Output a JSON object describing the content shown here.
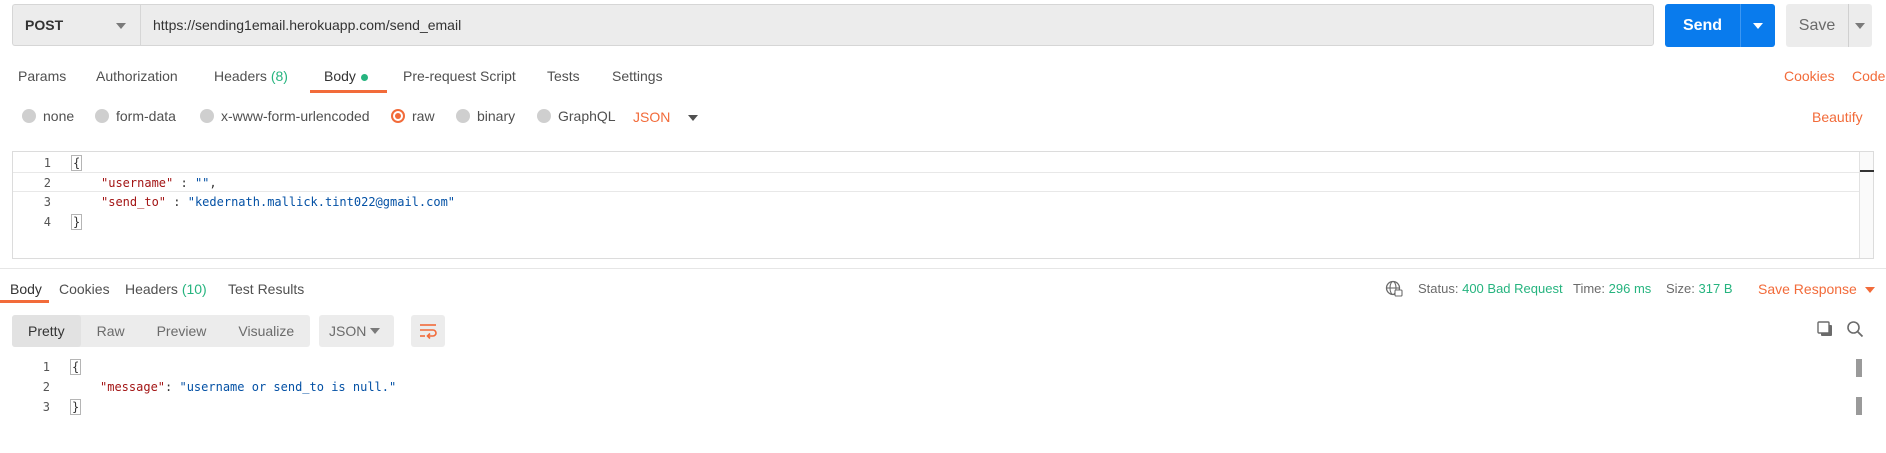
{
  "request": {
    "method": "POST",
    "url": "https://sending1email.herokuapp.com/send_email",
    "send_label": "Send",
    "save_label": "Save"
  },
  "request_tabs": [
    {
      "label": "Params"
    },
    {
      "label": "Authorization"
    },
    {
      "label": "Headers",
      "count": "(8)"
    },
    {
      "label": "Body"
    },
    {
      "label": "Pre-request Script"
    },
    {
      "label": "Tests"
    },
    {
      "label": "Settings"
    }
  ],
  "right_links": {
    "cookies": "Cookies",
    "code": "Code",
    "beautify": "Beautify"
  },
  "body_options": {
    "none": "none",
    "form_data": "form-data",
    "urlencoded": "x-www-form-urlencoded",
    "raw": "raw",
    "binary": "binary",
    "graphql": "GraphQL",
    "format": "JSON"
  },
  "request_body": {
    "line_numbers": [
      "1",
      "2",
      "3",
      "4"
    ],
    "open": "{",
    "k1": "\"username\"",
    "sep1": " : ",
    "v1": "\"\"",
    "comma1": ",",
    "k2": "\"send_to\"",
    "sep2": " : ",
    "v2": "\"kedernath.mallick.tint022@gmail.com\"",
    "close": "}"
  },
  "response_tabs": {
    "body": "Body",
    "cookies": "Cookies",
    "headers": "Headers",
    "headers_count": "(10)",
    "test_results": "Test Results"
  },
  "response_status": {
    "status_label": "Status:",
    "status_value": "400 Bad Request",
    "time_label": "Time:",
    "time_value": "296 ms",
    "size_label": "Size:",
    "size_value": "317 B",
    "save_response": "Save Response"
  },
  "response_view": {
    "modes": [
      "Pretty",
      "Raw",
      "Preview",
      "Visualize"
    ],
    "format": "JSON"
  },
  "response_body": {
    "line_numbers": [
      "1",
      "2",
      "3"
    ],
    "open": "{",
    "k1": "\"message\"",
    "sep1": ": ",
    "v1": "\"username or send_to is null.\"",
    "close": "}"
  },
  "colors": {
    "accent": "#f26b3a",
    "send_blue": "#097bed",
    "success_green": "#26b47f"
  }
}
